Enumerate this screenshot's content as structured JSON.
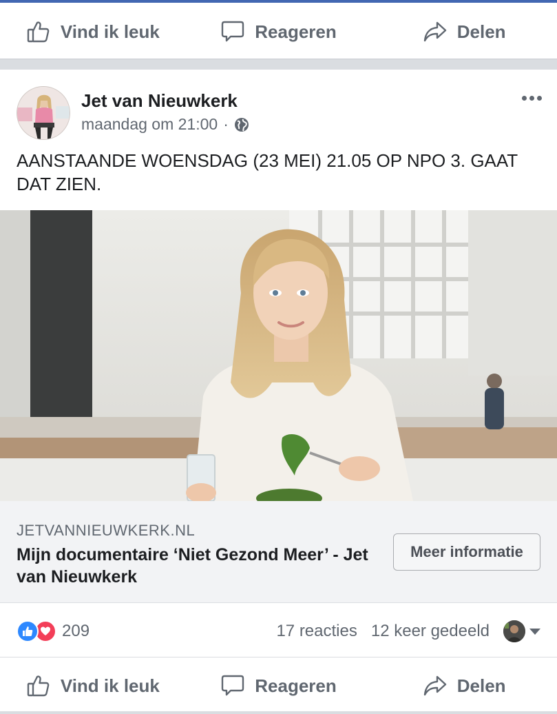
{
  "actions": {
    "like": "Vind ik leuk",
    "comment": "Reageren",
    "share": "Delen"
  },
  "post": {
    "author": "Jet van Nieuwkerk",
    "timestamp": "maandag om 21:00",
    "separator": "·",
    "text": "AANSTAANDE WOENSDAG (23 MEI) 21.05 OP NPO 3. GAAT DAT ZIEN."
  },
  "link_preview": {
    "domain": "JETVANNIEUWKERK.NL",
    "title": "Mijn documentaire ‘Niet Gezond Meer’ - Jet van Nieuwkerk",
    "cta": "Meer informatie"
  },
  "stats": {
    "reactions_count": "209",
    "comments": "17 reacties",
    "shares": "12 keer gedeeld"
  },
  "colors": {
    "brand_blue": "#4267b2",
    "like_blue": "#2d88ff",
    "love_red": "#f33e58",
    "secondary_text": "#606770"
  },
  "icons": [
    "thumbs-up-icon",
    "comment-bubble-icon",
    "share-arrow-icon",
    "globe-icon",
    "more-dots-icon",
    "like-reaction-icon",
    "love-reaction-icon",
    "chevron-down-icon"
  ]
}
